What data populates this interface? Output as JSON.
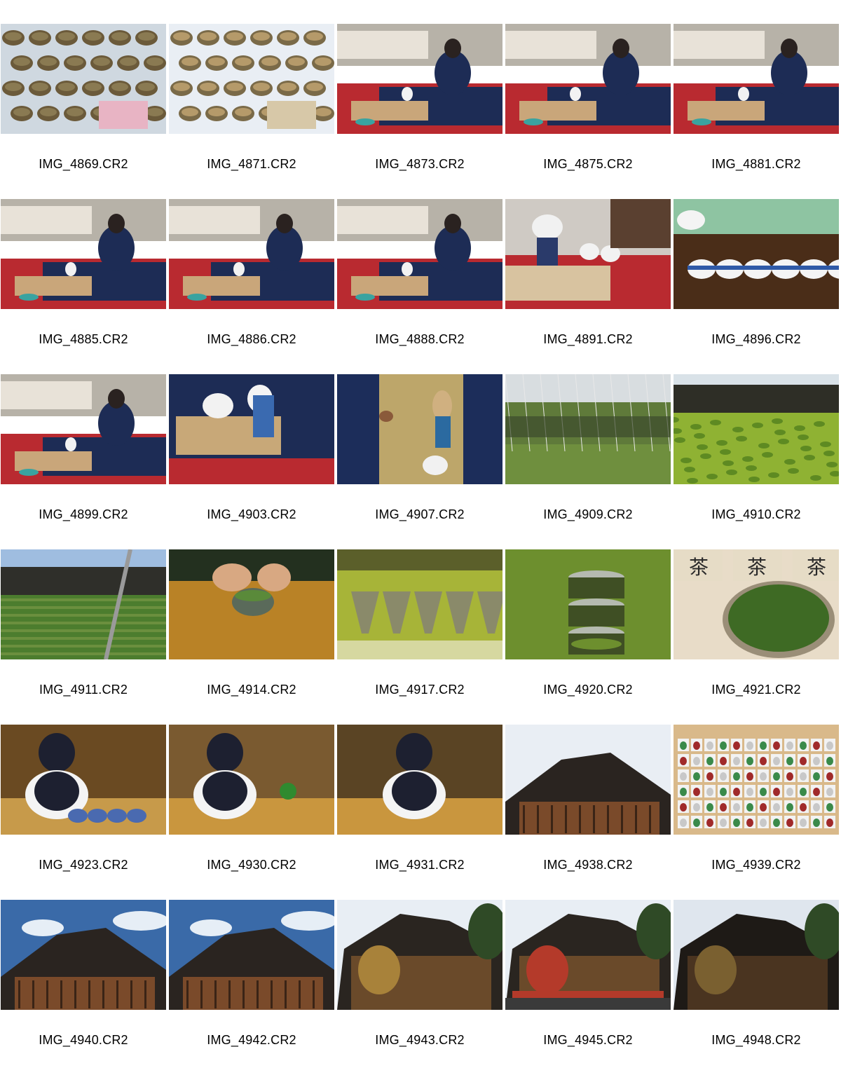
{
  "contact_sheet": {
    "thumbnails": [
      {
        "filename": "IMG_4869.CR2",
        "scene": "tea-bowls-and-hands",
        "palette": [
          "#cfd8e0",
          "#6b5a3a",
          "#8a7a52",
          "#e8b4c4"
        ]
      },
      {
        "filename": "IMG_4871.CR2",
        "scene": "tea-bowls-on-cloth",
        "palette": [
          "#e9eef4",
          "#7a6a48",
          "#b59a6a",
          "#d7c8a8"
        ]
      },
      {
        "filename": "IMG_4873.CR2",
        "scene": "tea-ceremony-seated",
        "palette": [
          "#b92a30",
          "#1d2c55",
          "#d8cfc0",
          "#c9a67a"
        ]
      },
      {
        "filename": "IMG_4875.CR2",
        "scene": "tea-ceremony-seated",
        "palette": [
          "#b92a30",
          "#1d2c55",
          "#d8cfc0",
          "#c9a67a"
        ]
      },
      {
        "filename": "IMG_4881.CR2",
        "scene": "tea-ceremony-seated",
        "palette": [
          "#b92a30",
          "#1d2c55",
          "#d8cfc0",
          "#c9a67a"
        ]
      },
      {
        "filename": "IMG_4885.CR2",
        "scene": "tea-ceremony-seated",
        "palette": [
          "#b92a30",
          "#1d2c55",
          "#d8cfc0",
          "#c9a67a"
        ]
      },
      {
        "filename": "IMG_4886.CR2",
        "scene": "tea-ceremony-seated",
        "palette": [
          "#b92a30",
          "#1d2c55",
          "#d8cfc0",
          "#c9a67a"
        ]
      },
      {
        "filename": "IMG_4888.CR2",
        "scene": "tea-ceremony-seated",
        "palette": [
          "#b92a30",
          "#1d2c55",
          "#d8cfc0",
          "#c9a67a"
        ]
      },
      {
        "filename": "IMG_4891.CR2",
        "scene": "teapot-closeup",
        "palette": [
          "#b92a30",
          "#2a3a6a",
          "#f1f1f1",
          "#5a4030"
        ]
      },
      {
        "filename": "IMG_4896.CR2",
        "scene": "pouring-tea-cups",
        "palette": [
          "#4a2d18",
          "#8ec4a2",
          "#f4f4f4",
          "#2f5aa8"
        ]
      },
      {
        "filename": "IMG_4899.CR2",
        "scene": "tea-ceremony-seated",
        "palette": [
          "#b92a30",
          "#1d2c55",
          "#d8cfc0",
          "#c9a67a"
        ]
      },
      {
        "filename": "IMG_4903.CR2",
        "scene": "tea-tray-utensils",
        "palette": [
          "#1d2c55",
          "#c8a878",
          "#f2f2f2",
          "#b92a30"
        ]
      },
      {
        "filename": "IMG_4907.CR2",
        "scene": "tea-table-overhead",
        "palette": [
          "#1c2d5a",
          "#bda66a",
          "#f1f1f1",
          "#2b6aa0"
        ]
      },
      {
        "filename": "IMG_4909.CR2",
        "scene": "tea-field-nets",
        "palette": [
          "#d8dde0",
          "#3c4a2c",
          "#5f7a3a",
          "#8aa0a8"
        ]
      },
      {
        "filename": "IMG_4910.CR2",
        "scene": "tea-field-green",
        "palette": [
          "#d9e2e8",
          "#2e2e26",
          "#8fb233",
          "#5e8a22"
        ]
      },
      {
        "filename": "IMG_4911.CR2",
        "scene": "tea-field-rows",
        "palette": [
          "#9fbde0",
          "#2f2f2a",
          "#4c7d2e",
          "#6b8f3e"
        ]
      },
      {
        "filename": "IMG_4914.CR2",
        "scene": "whisking-matcha",
        "palette": [
          "#b98226",
          "#23301f",
          "#d8a882",
          "#5a8a3a"
        ]
      },
      {
        "filename": "IMG_4917.CR2",
        "scene": "tea-grinders",
        "palette": [
          "#a7b438",
          "#5b5f2a",
          "#d6d8a0",
          "#8a8a6a"
        ]
      },
      {
        "filename": "IMG_4920.CR2",
        "scene": "tea-canisters",
        "palette": [
          "#6d8f2e",
          "#b5bab0",
          "#3f4f24",
          "#9aa28a"
        ]
      },
      {
        "filename": "IMG_4921.CR2",
        "scene": "tea-leaves-tin",
        "palette": [
          "#e8dcc8",
          "#3e6a24",
          "#9a8e78",
          "#2a2a2a"
        ]
      },
      {
        "filename": "IMG_4923.CR2",
        "scene": "girl-pouring-tea",
        "palette": [
          "#6a4a22",
          "#f4f4f4",
          "#1d2030",
          "#c79a4a"
        ]
      },
      {
        "filename": "IMG_4930.CR2",
        "scene": "girl-at-table",
        "palette": [
          "#7a5a30",
          "#f4f4f4",
          "#1d2030",
          "#c9963e"
        ]
      },
      {
        "filename": "IMG_4931.CR2",
        "scene": "girl-thinking",
        "palette": [
          "#5a4424",
          "#f4f4f4",
          "#1d2030",
          "#c9963e"
        ]
      },
      {
        "filename": "IMG_4938.CR2",
        "scene": "temple-roof",
        "palette": [
          "#e9eef4",
          "#2a2420",
          "#7a4a2a",
          "#b8c4d0"
        ]
      },
      {
        "filename": "IMG_4939.CR2",
        "scene": "display-shelf",
        "palette": [
          "#d9b98a",
          "#f2f2f2",
          "#3a8a4a",
          "#a02a2a"
        ]
      },
      {
        "filename": "IMG_4940.CR2",
        "scene": "temple-roof-sky",
        "palette": [
          "#3a6aa8",
          "#2a2420",
          "#7a4a2a",
          "#e6eef6"
        ]
      },
      {
        "filename": "IMG_4942.CR2",
        "scene": "temple-roof-sky",
        "palette": [
          "#3a6aa8",
          "#2a2420",
          "#7a4a2a",
          "#e6eef6"
        ]
      },
      {
        "filename": "IMG_4943.CR2",
        "scene": "temple-trees",
        "palette": [
          "#e8eef4",
          "#2a2520",
          "#6a4a2a",
          "#a8823a"
        ]
      },
      {
        "filename": "IMG_4945.CR2",
        "scene": "temple-market",
        "palette": [
          "#e8eef4",
          "#2a2520",
          "#6a4a2a",
          "#b43a2a"
        ]
      },
      {
        "filename": "IMG_4948.CR2",
        "scene": "temple-dark",
        "palette": [
          "#dfe6ee",
          "#1e1a16",
          "#4a3420",
          "#7a6030"
        ]
      }
    ]
  }
}
